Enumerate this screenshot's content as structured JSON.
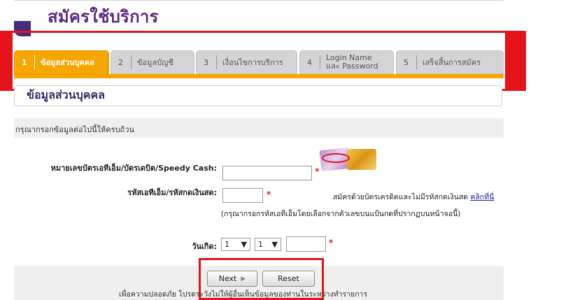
{
  "header": {
    "title": "สมัครใช้บริการ"
  },
  "steps": [
    {
      "num": "1",
      "label": "ข้อมูลส่วนบุคคล",
      "active": true
    },
    {
      "num": "2",
      "label": "ข้อมูลบัญชี",
      "active": false
    },
    {
      "num": "3",
      "label": "เงื่อนไขการบริการ",
      "active": false
    },
    {
      "num": "4",
      "label_line1": "Login Name",
      "label_line2": "และ Password",
      "active": false
    },
    {
      "num": "5",
      "label": "เสร็จสิ้นการสมัคร",
      "active": false
    }
  ],
  "section": {
    "title": "ข้อมูลส่วนบุคคล"
  },
  "instruction": "กรุณากรอกข้อมูลต่อไปนี้ให้ครบถ้วน",
  "form": {
    "card_number_label": "หมายเลขบัตรเอทีเอ็ม/บัตรเดบิต/Speedy Cash:",
    "card_number_value": "",
    "pin_label": "รหัสเอทีเอ็ม/รหัสกดเงินสด:",
    "pin_value": "",
    "credit_card_text": "สมัครด้วยบัตรเครดิตและไม่มีรหัสกดเงินสด",
    "click_here": "คลิกที่นี่",
    "pin_help": "(กรุณากรอกรหัสเอทีเอ็มโดยเลือกจากตัวเลขบนแป้นกดที่ปรากฏบนหน้าจอนี้)",
    "dob_label": "วันเกิด:",
    "dob_day": "1",
    "dob_month": "1",
    "dob_year": "",
    "required_mark": "*"
  },
  "buttons": {
    "next": "Next",
    "reset": "Reset"
  },
  "footnote": "เพื่อความปลอดภัย โปรดระวังไม่ให้ผู้อื่นเห็นข้อมูลของท่านในระหว่างทำรายการ",
  "colors": {
    "accent": "#f5a600",
    "highlight": "#e5141b",
    "brand": "#5b2a86"
  },
  "icons": {
    "next_arrow": "triangle-right-icon",
    "select_arrow": "triangle-down-icon"
  }
}
